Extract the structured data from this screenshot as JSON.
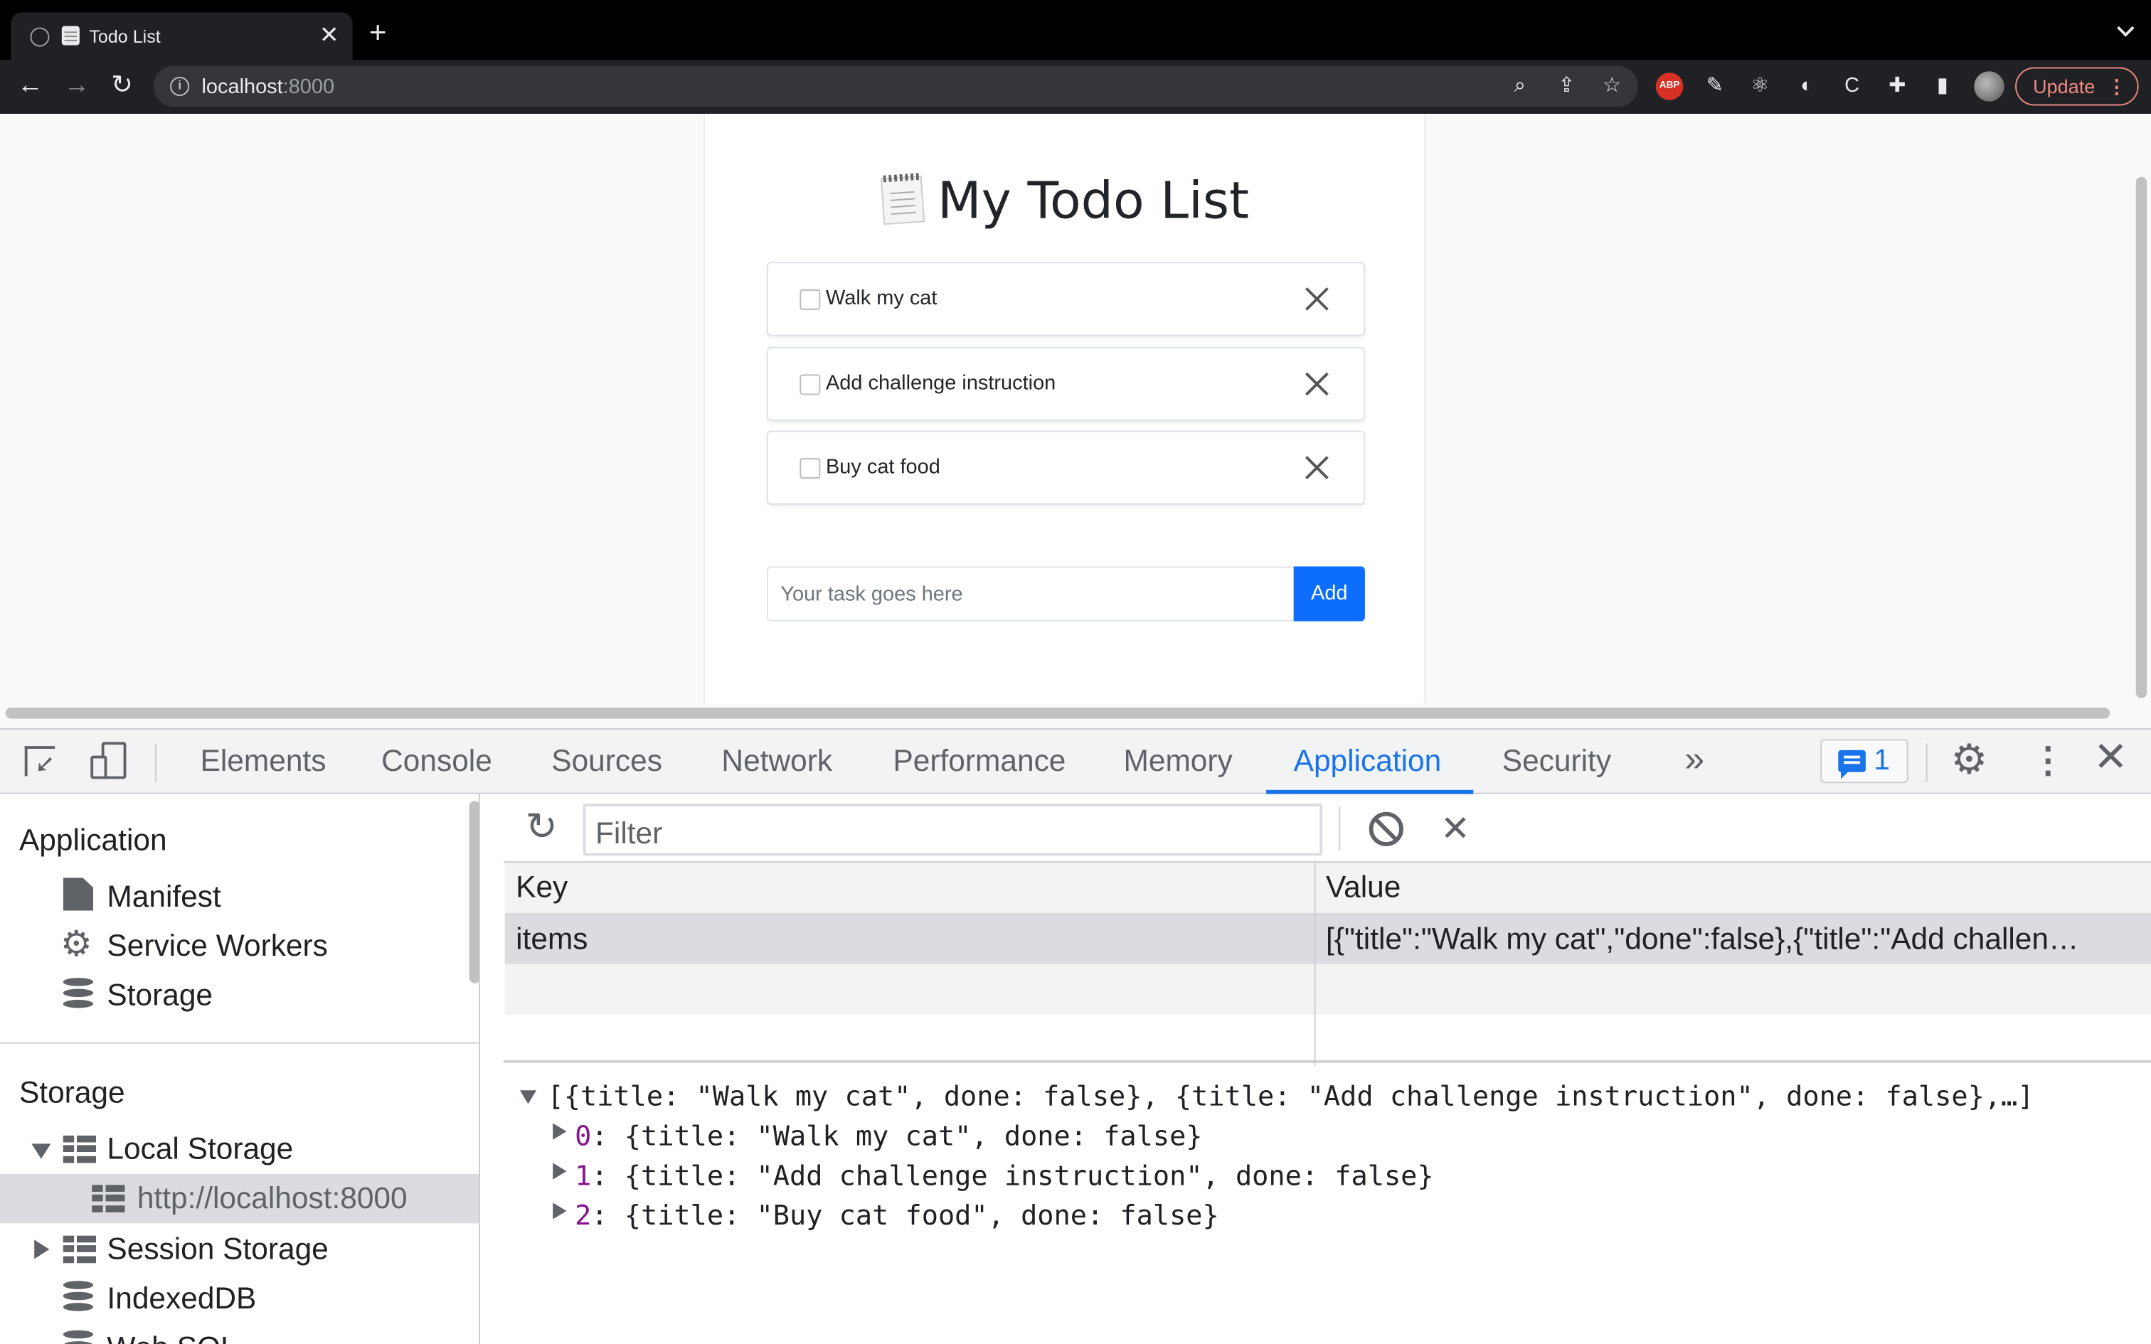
{
  "browser": {
    "tab_title": "Todo List",
    "url_host": "localhost",
    "url_port": ":8000",
    "update_label": "Update"
  },
  "page": {
    "title": "My Todo List",
    "todos": [
      {
        "label": "Walk my cat",
        "done": false
      },
      {
        "label": "Add challenge instruction",
        "done": false
      },
      {
        "label": "Buy cat food",
        "done": false
      }
    ],
    "input_placeholder": "Your task goes here",
    "add_label": "Add",
    "accent": "#0d6efd"
  },
  "devtools": {
    "tabs": [
      "Elements",
      "Console",
      "Sources",
      "Network",
      "Performance",
      "Memory",
      "Application",
      "Security"
    ],
    "active_tab": "Application",
    "issues_count": "1",
    "sidebar": {
      "application_header": "Application",
      "application_items": [
        "Manifest",
        "Service Workers",
        "Storage"
      ],
      "storage_header": "Storage",
      "local_storage": "Local Storage",
      "local_storage_origin": "http://localhost:8000",
      "session_storage": "Session Storage",
      "indexeddb": "IndexedDB",
      "websql": "Web SQL"
    },
    "filter_placeholder": "Filter",
    "table": {
      "headers": [
        "Key",
        "Value"
      ],
      "rows": [
        {
          "key": "items",
          "value": "[{\"title\":\"Walk my cat\",\"done\":false},{\"title\":\"Add challen…"
        }
      ]
    },
    "preview": {
      "summary": "[{title: \"Walk my cat\", done: false}, {title: \"Add challenge instruction\", done: false},…]",
      "entries": [
        {
          "index": "0",
          "text": ": {title: \"Walk my cat\", done: false}"
        },
        {
          "index": "1",
          "text": ": {title: \"Add challenge instruction\", done: false}"
        },
        {
          "index": "2",
          "text": ": {title: \"Buy cat food\", done: false}"
        }
      ]
    },
    "accent": "#1a73e8"
  }
}
